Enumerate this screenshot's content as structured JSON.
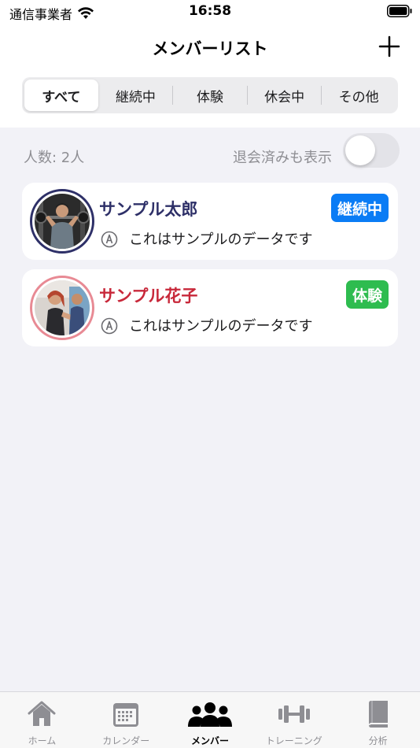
{
  "status_bar": {
    "carrier": "通信事業者",
    "time": "16:58"
  },
  "nav": {
    "title": "メンバーリスト",
    "add_icon": "plus-icon"
  },
  "segments": [
    {
      "label": "すべて",
      "selected": true
    },
    {
      "label": "継続中",
      "selected": false
    },
    {
      "label": "体験",
      "selected": false
    },
    {
      "label": "休会中",
      "selected": false
    },
    {
      "label": "その他",
      "selected": false
    }
  ],
  "summary": {
    "count_label": "人数: 2人",
    "show_withdrawn_label": "退会済みも表示",
    "show_withdrawn_on": false
  },
  "members": [
    {
      "name": "サンプル太郎",
      "status": "継続中",
      "memo": "これはサンプルのデータです",
      "name_color": "#2e3068",
      "badge_color": "#0a7cf5",
      "ring_color": "#2e3068"
    },
    {
      "name": "サンプル花子",
      "status": "体験",
      "memo": "これはサンプルのデータです",
      "name_color": "#c8283a",
      "badge_color": "#2ebc4f",
      "ring_color": "#e06070"
    }
  ],
  "tabbar": [
    {
      "label": "ホーム",
      "icon": "house-icon",
      "active": false
    },
    {
      "label": "カレンダー",
      "icon": "calendar-icon",
      "active": false
    },
    {
      "label": "メンバー",
      "icon": "people-icon",
      "active": true
    },
    {
      "label": "トレーニング",
      "icon": "dumbbell-icon",
      "active": false
    },
    {
      "label": "分析",
      "icon": "book-icon",
      "active": false
    }
  ]
}
